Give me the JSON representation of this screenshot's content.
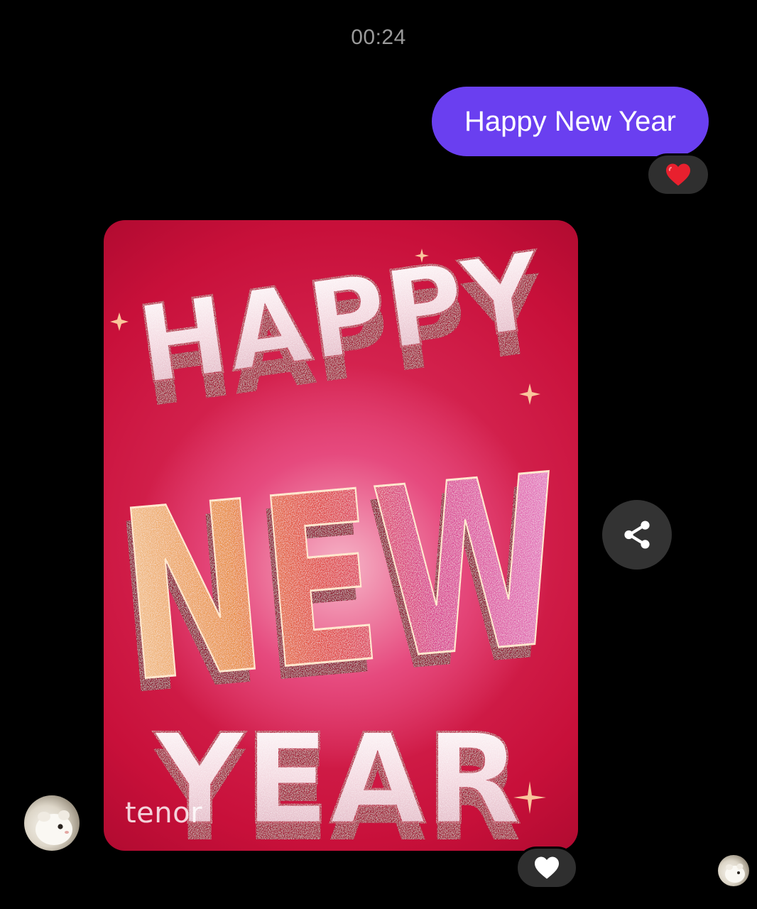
{
  "conversation": {
    "timestamp": "00:24"
  },
  "outgoing_message": {
    "text": "Happy New Year",
    "reaction": "red-heart-icon"
  },
  "incoming_gif": {
    "words": [
      "HAPPY",
      "NEW",
      "YEAR"
    ],
    "watermark": "tenor",
    "reaction": "white-heart-icon"
  },
  "actions": {
    "share": "share-icon"
  },
  "colors": {
    "background": "#000000",
    "outgoing_bubble": "#6a3ff0",
    "reaction_pill": "#2f2f2f",
    "share_button": "#333333",
    "timestamp_text": "#9a9a9a"
  }
}
